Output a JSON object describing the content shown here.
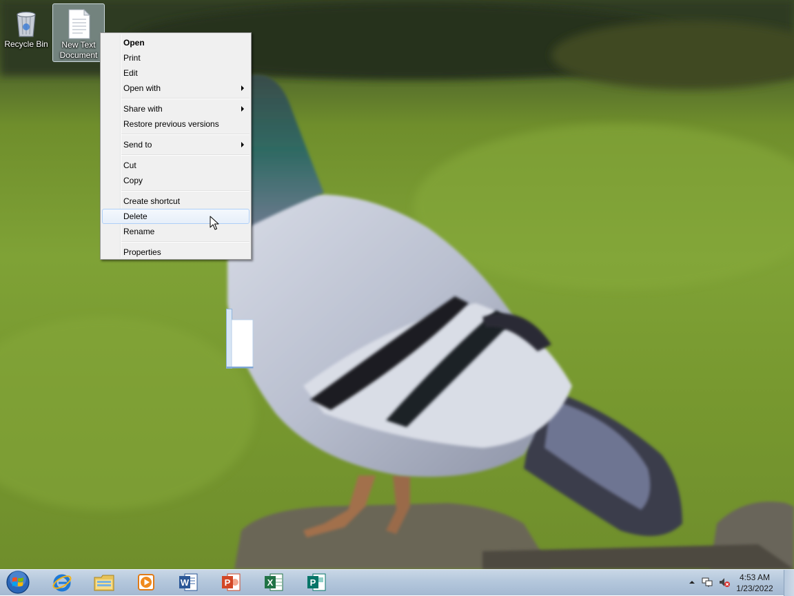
{
  "desktop": {
    "icons": [
      {
        "label": "Recycle Bin",
        "icon": "recycle-bin-icon"
      },
      {
        "label": "New Text Document",
        "icon": "text-document-icon",
        "selected": true
      }
    ]
  },
  "context_menu": {
    "items": [
      {
        "label": "Open",
        "default": true
      },
      {
        "label": "Print"
      },
      {
        "label": "Edit"
      },
      {
        "label": "Open with",
        "submenu": true
      },
      {
        "label": "Share with",
        "submenu": true
      },
      {
        "label": "Restore previous versions"
      },
      {
        "label": "Send to",
        "submenu": true
      },
      {
        "label": "Cut"
      },
      {
        "label": "Copy"
      },
      {
        "label": "Create shortcut"
      },
      {
        "label": "Delete",
        "highlighted": true
      },
      {
        "label": "Rename"
      },
      {
        "label": "Properties"
      }
    ]
  },
  "taskbar": {
    "start": "windows-start-orb",
    "pinned": [
      {
        "app": "Internet Explorer",
        "icon": "internet-explorer-icon"
      },
      {
        "app": "Windows Explorer",
        "icon": "file-explorer-icon"
      },
      {
        "app": "Windows Media Player",
        "icon": "media-player-icon"
      },
      {
        "app": "Microsoft Word",
        "icon": "word-icon"
      },
      {
        "app": "Microsoft PowerPoint",
        "icon": "powerpoint-icon"
      },
      {
        "app": "Microsoft Excel",
        "icon": "excel-icon"
      },
      {
        "app": "Microsoft Publisher",
        "icon": "publisher-icon"
      }
    ],
    "tray": {
      "icons": [
        "show-hidden-icons-icon",
        "network-icon",
        "volume-muted-icon"
      ],
      "time": "4:53 AM",
      "date": "1/23/2022"
    }
  },
  "colors": {
    "menu_highlight_border": "#aecff7",
    "taskbar_top": "#c9d7e6",
    "word": "#2b5797",
    "powerpoint": "#d24726",
    "excel": "#217346",
    "publisher": "#077568"
  }
}
